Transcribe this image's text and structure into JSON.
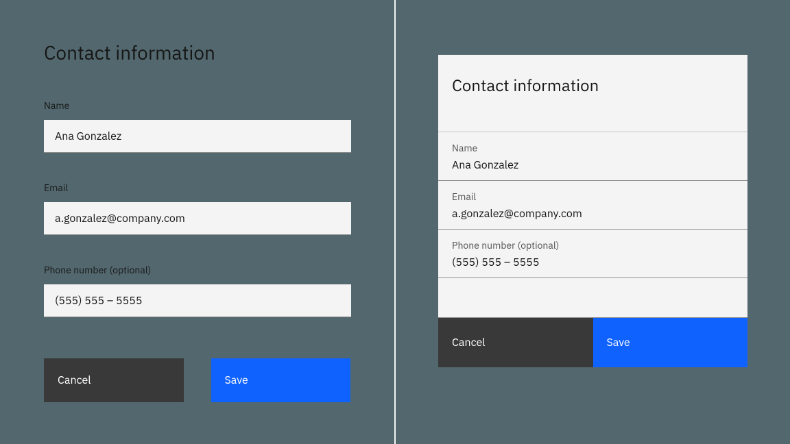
{
  "left": {
    "title": "Contact information",
    "fields": {
      "name": {
        "label": "Name",
        "value": "Ana Gonzalez"
      },
      "email": {
        "label": "Email",
        "value": "a.gonzalez@company.com"
      },
      "phone": {
        "label": "Phone number (optional)",
        "value": "(555) 555 – 5555"
      }
    },
    "buttons": {
      "cancel": "Cancel",
      "save": "Save"
    }
  },
  "right": {
    "title": "Contact information",
    "fields": {
      "name": {
        "label": "Name",
        "value": "Ana Gonzalez"
      },
      "email": {
        "label": "Email",
        "value": "a.gonzalez@company.com"
      },
      "phone": {
        "label": "Phone number (optional)",
        "value": "(555) 555 – 5555"
      }
    },
    "buttons": {
      "cancel": "Cancel",
      "save": "Save"
    }
  },
  "colors": {
    "background": "#53686e",
    "surface": "#f4f4f4",
    "primary": "#0f62fe",
    "secondary": "#393939"
  }
}
